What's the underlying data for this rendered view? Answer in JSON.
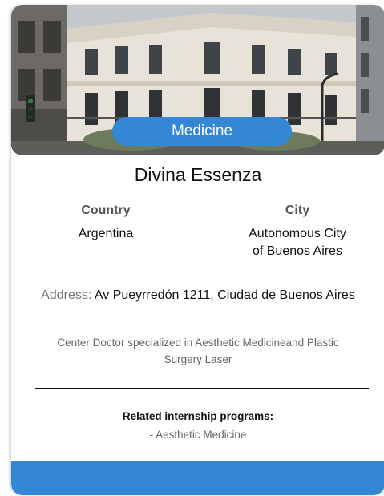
{
  "card": {
    "category_badge": "Medicine",
    "name": "Divina Essenza",
    "country_label": "Country",
    "country_value": "Argentina",
    "city_label": "City",
    "city_value_line1": "Autonomous City",
    "city_value_line2": "of Buenos Aires",
    "address_label": "Address:",
    "address_value": "Av Pueyrredón 1211, Ciudad de Buenos Aires",
    "description_line1": "Center Doctor specialized in Aesthetic Medicineand Plastic",
    "description_line2": "Surgery Laser",
    "related_title": "Related internship programs:",
    "related_items": [
      "- Aesthetic Medicine"
    ]
  },
  "colors": {
    "accent": "#3487d4",
    "text_primary": "#111111",
    "text_muted": "#666666"
  },
  "icons": {
    "hero_image": "building-photo"
  }
}
